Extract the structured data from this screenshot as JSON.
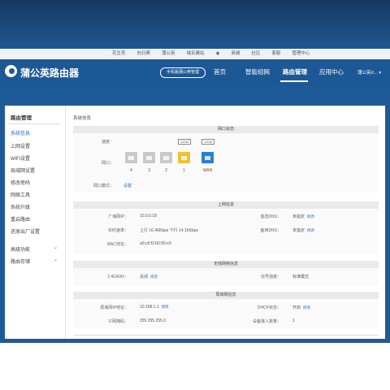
{
  "toplinks": [
    "花生壳",
    "向日葵",
    "蒲公英",
    "域名建站",
    "商城",
    "社区",
    "客服",
    "管理中心"
  ],
  "brand": "蒲公英路由器",
  "mgmt_button": "手机版蒲公英管理",
  "nav": [
    "首页",
    "智能组网",
    "路由管理",
    "应用中心"
  ],
  "user": "蒲公英X...",
  "sidebar": {
    "title": "路由管理",
    "items": [
      "系统信息",
      "上网设置",
      "WiFi设置",
      "局域网设置",
      "修改密码",
      "网络工具",
      "系统升级",
      "重启路由",
      "还原出厂设置",
      "高级功能",
      "路由存储"
    ],
    "active": "系统信息"
  },
  "crumb": "系统信息",
  "port_status": {
    "title": "网口状态",
    "speed_label": "速度：",
    "port_label": "网口：",
    "mode_label": "网口模式：",
    "mode_value": "设置",
    "speed_tags": [
      "100M",
      "100M"
    ],
    "port_numbers": [
      "4",
      "3",
      "2",
      "1",
      "WAN"
    ],
    "colors": {
      "idle": "#c9c9c9",
      "lan_active": "#f2c12e",
      "wan_active": "#2b7fd4"
    }
  },
  "internet": {
    "title": "上网信息",
    "wan_ip_label": "广域网IP：",
    "wan_ip": "10.0.0.18",
    "dns1_label": "首选DNS：",
    "dns1": "未指定",
    "dns1_edit": "修改",
    "rate_label": "实时速率：",
    "rate": "上行 16.46Kbps  下行 14.16Kbps",
    "dns2_label": "备用DNS：",
    "dns2": "未指定",
    "dns2_edit": "修改",
    "mac_label": "MAC地址：",
    "mac": "a0:c5:f2:b0:90:e3"
  },
  "wireless": {
    "title": "无线网络信息",
    "wifi_label": "2.4GWiFi：",
    "wifi": "关闭",
    "wifi_edit": "修改",
    "signal_label": "信号强度：",
    "signal": "标准模式"
  },
  "lan": {
    "title": "局域网信息",
    "ip_label": "局域网IP地址：",
    "ip": "10.168.1.1",
    "ip_edit": "修改",
    "dhcp_label": "DHCP状态：",
    "dhcp": "开启",
    "dhcp_edit": "修改",
    "mask_label": "子网掩码：",
    "mask": "255.255.255.0",
    "devices_label": "设备接入数量：",
    "devices": "1"
  },
  "colors": {
    "accent": "#1d6fd0",
    "header": "#1d5896"
  }
}
